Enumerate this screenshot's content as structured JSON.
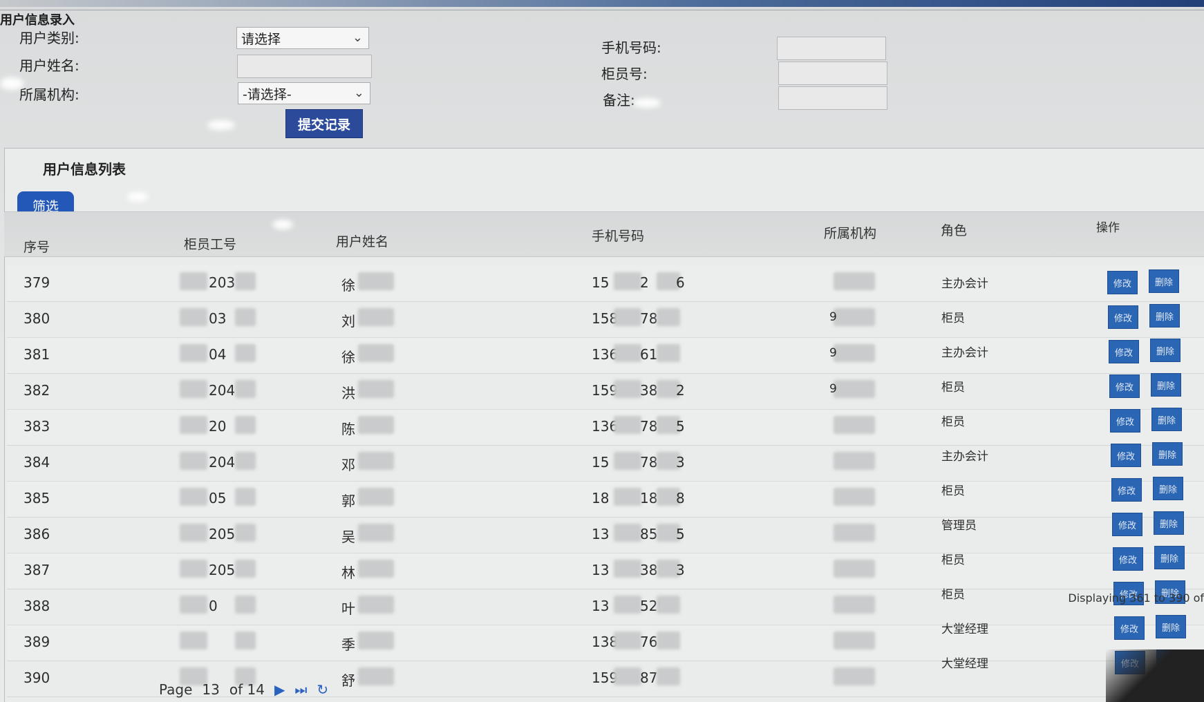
{
  "form": {
    "legend": "用户信息录入",
    "user_type_label": "用户类别:",
    "user_type_value": "请选择",
    "user_name_label": "用户姓名:",
    "org_label": "所属机构:",
    "org_value": "-请选择-",
    "phone_label": "手机号码:",
    "teller_no_label": "柜员号:",
    "remark_label": "备注:",
    "submit_label": "提交记录"
  },
  "list": {
    "title": "用户信息列表",
    "filter_label": "筛选",
    "columns": [
      "序号",
      "柜员工号",
      "用户姓名",
      "手机号码",
      "所属机构",
      "角色",
      "操作"
    ],
    "edit_label": "修改",
    "delete_label": "删除",
    "rows": [
      {
        "no": "379",
        "teller": "203",
        "name": "徐",
        "phone_a": "15",
        "phone_b": "2",
        "phone_c": "6",
        "org": "",
        "role": "主办会计"
      },
      {
        "no": "380",
        "teller": "03",
        "name": "刘",
        "phone_a": "158",
        "phone_b": "782",
        "phone_c": "",
        "org": "9",
        "role": "柜员"
      },
      {
        "no": "381",
        "teller": "04",
        "name": "徐",
        "phone_a": "136",
        "phone_b": "61",
        "phone_c": "",
        "org": "9",
        "role": "主办会计"
      },
      {
        "no": "382",
        "teller": "204",
        "name": "洪",
        "phone_a": "159",
        "phone_b": "38",
        "phone_c": "2",
        "org": "9",
        "role": "柜员"
      },
      {
        "no": "383",
        "teller": "20",
        "name": "陈",
        "phone_a": "136",
        "phone_b": "78",
        "phone_c": "5",
        "org": "",
        "role": "柜员"
      },
      {
        "no": "384",
        "teller": "204",
        "name": "邓",
        "phone_a": "15",
        "phone_b": "78",
        "phone_c": "3",
        "org": "",
        "role": "主办会计"
      },
      {
        "no": "385",
        "teller": "05",
        "name": "郭",
        "phone_a": "18",
        "phone_b": "18",
        "phone_c": "8",
        "org": "",
        "role": "柜员"
      },
      {
        "no": "386",
        "teller": "205",
        "name": "吴",
        "phone_a": "13",
        "phone_b": "85",
        "phone_c": "5",
        "org": "",
        "role": "管理员"
      },
      {
        "no": "387",
        "teller": "205",
        "name": "林",
        "phone_a": "13",
        "phone_b": "388",
        "phone_c": "3",
        "org": "",
        "role": "柜员"
      },
      {
        "no": "388",
        "teller": "0",
        "name": "叶",
        "phone_a": "13",
        "phone_b": "529",
        "phone_c": "",
        "org": "",
        "role": "柜员"
      },
      {
        "no": "389",
        "teller": "",
        "name": "季",
        "phone_a": "138",
        "phone_b": "76",
        "phone_c": "",
        "org": "",
        "role": "大堂经理"
      },
      {
        "no": "390",
        "teller": "",
        "name": "舒",
        "phone_a": "159",
        "phone_b": "87",
        "phone_c": "",
        "org": "",
        "role": "大堂经理"
      }
    ]
  },
  "pager": {
    "page_label": "Page",
    "page_value": "13",
    "of_label": "of 14",
    "next_icon": "next-page-icon",
    "last_icon": "last-page-icon",
    "refresh_icon": "refresh-icon",
    "displaying": "Displaying 361 to 390 of"
  },
  "colors": {
    "button_blue": "#2b4a9a",
    "filter_blue": "#2357b8",
    "action_blue": "#2b66b5"
  }
}
